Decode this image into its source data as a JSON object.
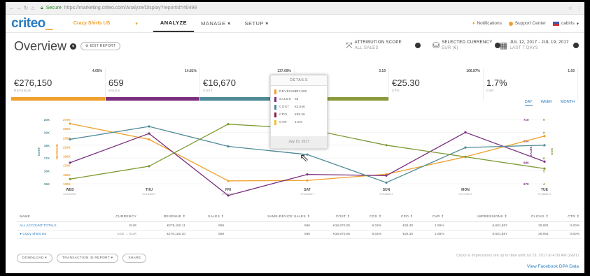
{
  "browser": {
    "secure_label": "Secure",
    "url": "https://marketing.criteo.com/Analyze/Display?reportId=40499"
  },
  "header": {
    "logo_text": "criteo",
    "advertiser": "Crazy Shirts US",
    "tabs": [
      {
        "label": "ANALYZE",
        "active": true
      },
      {
        "label": "MANAGE ▾",
        "active": false
      },
      {
        "label": "SETUP ▾",
        "active": false
      }
    ],
    "notifications_label": "Notifications",
    "support_label": "Support Center",
    "user_label": "cabirls"
  },
  "overview": {
    "title": "Overview",
    "edit_report_label": "EDIT REPORT",
    "attribution_title": "ATTRIBUTION SCOPE",
    "attribution_value": "ALL SALES",
    "currency_title": "SELECTED CURRENCY",
    "currency_value": "EUR (€)",
    "date_title": "JUL 12, 2017 - JUL 19, 2017",
    "date_value": "LAST 7 DAYS"
  },
  "kpis": [
    {
      "value": "€276,150",
      "label": "REVENUE",
      "change": "4.05%",
      "color": "#f0a02e"
    },
    {
      "value": "659",
      "label": "SALES",
      "change": "14.81%",
      "color": "#7a2f7e"
    },
    {
      "value": "€16,670",
      "label": "COST",
      "change": "137.09%",
      "color": "#4e8a96"
    },
    {
      "value": "421",
      "label": "",
      "change": "3.19",
      "color": "#8a9a3a"
    },
    {
      "value": "€25.30",
      "label": "CPO",
      "change": "106.87%",
      "color": "#ffffff"
    },
    {
      "value": "1.7%",
      "label": "CVR",
      "change": "1.93",
      "color": "#ffffff"
    }
  ],
  "range_tabs": [
    "DAY",
    "WEEK",
    "MONTH"
  ],
  "tooltip": {
    "title": "DETAILS",
    "rows": [
      {
        "name": "REVENUE",
        "value": "€37,000",
        "color": "#f0a02e"
      },
      {
        "name": "SALES",
        "value": "65",
        "color": "#7a2f7e"
      },
      {
        "name": "COST",
        "value": "€2,546",
        "color": "#4e8a96"
      },
      {
        "name": "CPO",
        "value": "€38.26",
        "color": "#8a2040"
      },
      {
        "name": "CVR",
        "value": "1.5%",
        "color": "#f2c12e"
      }
    ],
    "date": "July 15, 2017"
  },
  "chart_data": {
    "type": "line",
    "x": [
      "WED",
      "THU",
      "FRI",
      "SAT",
      "SUN",
      "MON",
      "TUE"
    ],
    "x_dates": [
      "07/12/2017",
      "07/13/2017",
      "07/14/2017",
      "07/15/2017",
      "07/16/2017",
      "07/17/2017",
      "07/18/2017"
    ],
    "left_axis_outer": {
      "label": "COST",
      "ticks": [
        "20K",
        "19K",
        "18K",
        "17K",
        "16K",
        "15K"
      ],
      "range": [
        15,
        20.5
      ]
    },
    "left_axis_inner": {
      "label": "REVENUE",
      "ticks": [
        "270K",
        "250K",
        "230K",
        "210K",
        "190K",
        "170K",
        "150K",
        "130K"
      ],
      "range": [
        125,
        280
      ]
    },
    "right_axis_inner": {
      "label": "SALES",
      "ticks": [
        "710",
        "690",
        "680",
        "670"
      ],
      "range": [
        665,
        720
      ]
    },
    "right_axis_outer": {
      "label": "COS",
      "ticks": [
        "9",
        "8",
        "7",
        "6",
        "5",
        "4"
      ],
      "range": [
        4,
        9.5
      ]
    },
    "series": [
      {
        "name": "REVENUE",
        "color": "#f0a02e",
        "values": [
          270,
          232,
          132,
          133,
          148,
          190,
          240
        ]
      },
      {
        "name": "SALES",
        "color": "#7a2f7e",
        "values": [
          683,
          708,
          655,
          673,
          672,
          709,
          684
        ]
      },
      {
        "name": "COST",
        "color": "#4e8a96",
        "values": [
          18.8,
          19.9,
          18.2,
          17.5,
          15.1,
          18.1,
          18.3
        ]
      },
      {
        "name": "COS",
        "color": "#7d9a32",
        "values": [
          4.4,
          5.5,
          9.1,
          8.7,
          7.3,
          6.3,
          5.3
        ]
      }
    ],
    "hover": {
      "index": 3,
      "date": "July 15, 2017"
    },
    "grid": true
  },
  "table": {
    "headers": [
      "NAME",
      "CURRENCY",
      "REVENUE ⇕",
      "SALES ⇕",
      "SAME-DEVICE SALES ⇕",
      "COST ⇕",
      "COS ⇕",
      "CPO ⇕",
      "CVR ⇕",
      "IMPRESSIONS ⇕",
      "CLICKS ⇕",
      "CTR ⇕"
    ],
    "totals": [
      "ALL ACCOUNT TOTALS",
      "EUR",
      "€276,150.11",
      "659",
      "566",
      "€16,670.05",
      "6.04%",
      "€25.30",
      "1.65%",
      "6,601,887",
      "39,901",
      "0.60%"
    ],
    "row": [
      "Crazy Shirts US",
      "USD → EUR",
      "€276,150.10",
      "659",
      "566",
      "€16,670.05",
      "6.04%",
      "€25.30",
      "1.65%",
      "6,601,887",
      "39,901",
      "0.60%"
    ]
  },
  "footer": {
    "download_label": "DOWNLOAD ▾",
    "transaction_label": "TRANSACTION ID REPORT ▾",
    "share_label": "SHARE",
    "note": "Clicks & Impressions are up to date until Jul 19, 2017 at 4:00 AM (GMT)",
    "fb_link": "View Facebook DPA Data"
  }
}
